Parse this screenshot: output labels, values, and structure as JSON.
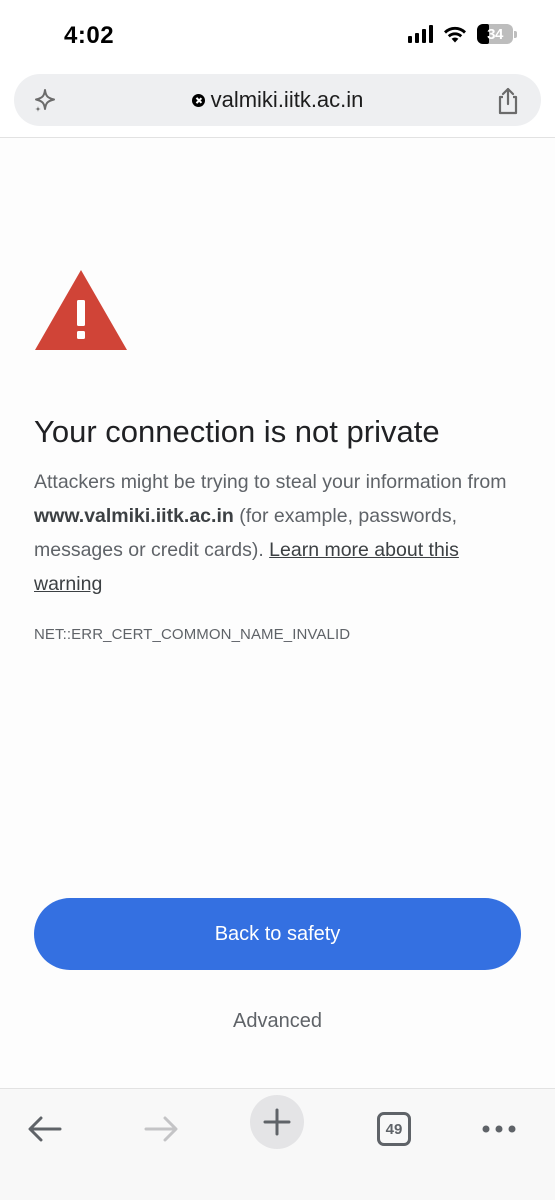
{
  "status_bar": {
    "time": "4:02",
    "battery_level": "34",
    "battery_fraction": 0.34
  },
  "address_bar": {
    "url": "valmiki.iitk.ac.in",
    "security_icon": "not-secure-x-icon",
    "left_icon": "sparkle-icon",
    "right_icon": "share-icon"
  },
  "interstitial": {
    "icon": "warning-triangle-icon",
    "icon_color": "#d04437",
    "headline": "Your connection is not private",
    "explanation_prefix": "Attackers might be trying to steal your information from ",
    "domain": "www.valmiki.iitk.ac.in",
    "explanation_middle": " (for example, passwords, messages or credit cards). ",
    "learn_more_link": "Learn more about this warning",
    "error_code": "NET::ERR_CERT_COMMON_NAME_INVALID",
    "primary_button": "Back to safety",
    "primary_color": "#3470e1",
    "advanced_button": "Advanced"
  },
  "toolbar": {
    "back_icon": "arrow-left-icon",
    "forward_icon": "arrow-right-icon",
    "new_tab_icon": "plus-icon",
    "tab_count": "49",
    "menu_icon": "more-horizontal-icon"
  }
}
